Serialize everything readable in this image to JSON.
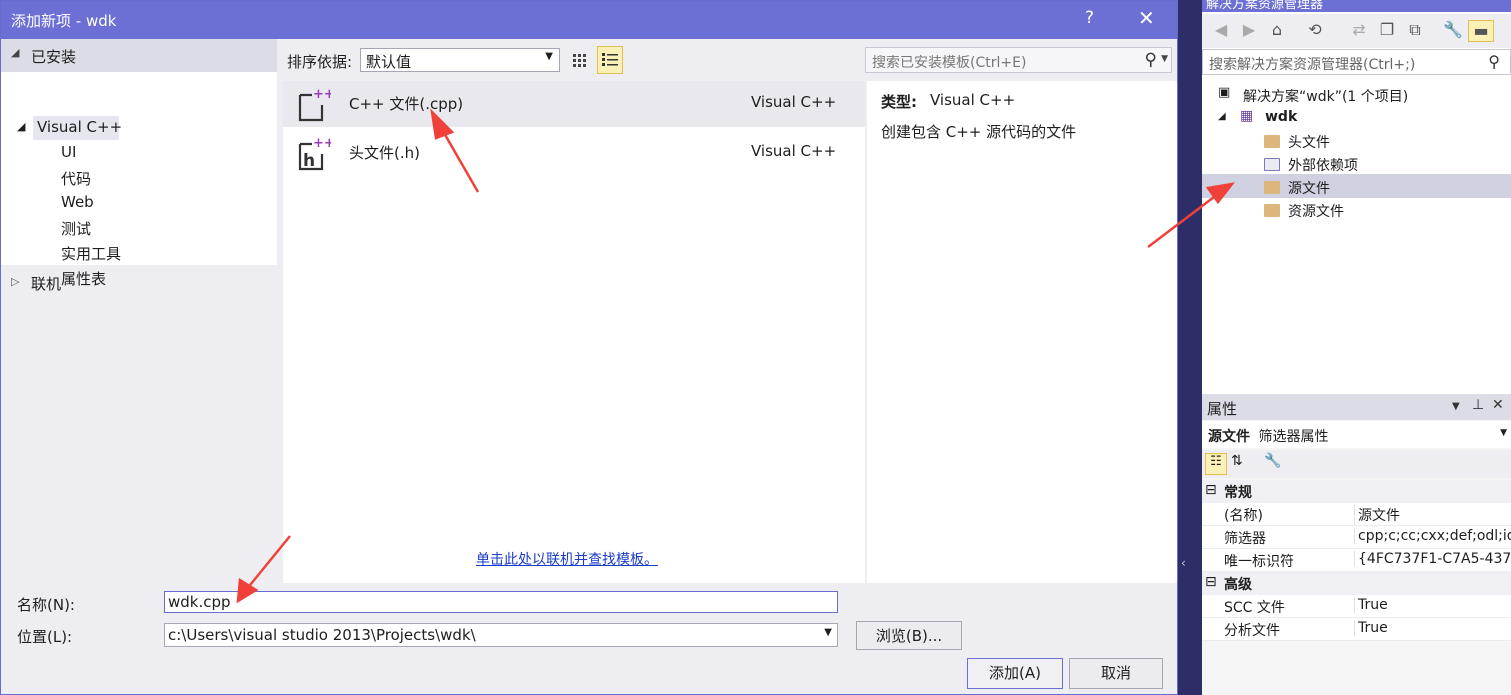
{
  "dialog": {
    "title": "添加新项 - wdk",
    "help_label": "?",
    "close_label": "✕",
    "installed_label": "已安装",
    "tree": {
      "root": "Visual C++",
      "children": [
        "UI",
        "代码",
        "Web",
        "测试",
        "实用工具",
        "属性表"
      ],
      "online": "联机"
    },
    "sort_label": "排序依据:",
    "sort_value": "默认值",
    "search_placeholder": "搜索已安装模板(Ctrl+E)",
    "templates": [
      {
        "name": "C++ 文件(.cpp)",
        "lang": "Visual C++",
        "selected": true
      },
      {
        "name": "头文件(.h)",
        "lang": "Visual C++",
        "selected": false
      }
    ],
    "online_link": "单击此处以联机并查找模板。",
    "details": {
      "type_label": "类型:",
      "type_value": "Visual C++",
      "description": "创建包含 C++ 源代码的文件"
    },
    "name_label": "名称(N):",
    "name_value": "wdk.cpp",
    "location_label": "位置(L):",
    "location_value": "c:\\Users\\visual studio 2013\\Projects\\wdk\\",
    "browse_label": "浏览(B)...",
    "add_label": "添加(A)",
    "cancel_label": "取消"
  },
  "solution_explorer": {
    "title": "解决方案资源管理器",
    "search_placeholder": "搜索解决方案资源管理器(Ctrl+;)",
    "solution_label": "解决方案“wdk”(1 个项目)",
    "project_label": "wdk",
    "items": [
      "头文件",
      "外部依赖项",
      "源文件",
      "资源文件"
    ]
  },
  "properties": {
    "title": "属性",
    "object_name": "源文件",
    "object_type": "筛选器属性",
    "categories": [
      {
        "name": "常规",
        "rows": [
          {
            "key": "(名称)",
            "value": "源文件"
          },
          {
            "key": "筛选器",
            "value": "cpp;c;cc;cxx;def;odl;idl"
          },
          {
            "key": "唯一标识符",
            "value": "{4FC737F1-C7A5-437"
          }
        ]
      },
      {
        "name": "高级",
        "rows": [
          {
            "key": "SCC 文件",
            "value": "True"
          },
          {
            "key": "分析文件",
            "value": "True"
          }
        ]
      }
    ]
  },
  "colors": {
    "title_bar": "#6c6fd4",
    "annotation_arrow": "#f0403a",
    "link": "#1a3cc8"
  },
  "icons": [
    "close-icon",
    "help-icon",
    "grid-view-icon",
    "list-view-icon",
    "search-icon",
    "folder-icon",
    "cpp-file-icon",
    "header-file-icon",
    "pin-icon",
    "wrench-icon"
  ]
}
